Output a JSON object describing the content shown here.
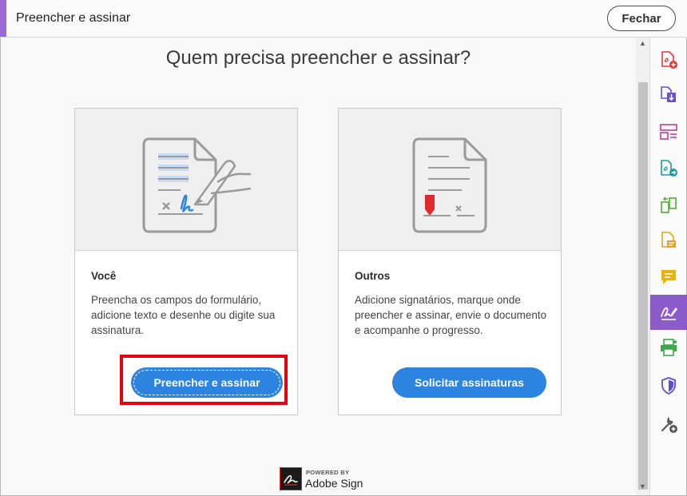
{
  "header": {
    "title": "Preencher e assinar",
    "close_label": "Fechar"
  },
  "main": {
    "question": "Quem precisa preencher e assinar?",
    "cards": [
      {
        "heading": "Você",
        "description": "Preencha os campos do formulário, adicione texto e desenhe ou digite sua assinatura.",
        "button_label": "Preencher e assinar"
      },
      {
        "heading": "Outros",
        "description": "Adicione signatários, marque onde preencher e assinar, envie o documento e acompanhe o progresso.",
        "button_label": "Solicitar assinaturas"
      }
    ]
  },
  "footer": {
    "powered_by": "POWERED BY",
    "brand": "Adobe Sign"
  },
  "tools": [
    {
      "icon": "create-pdf-icon",
      "color": "#e0393e"
    },
    {
      "icon": "export-pdf-icon",
      "color": "#6a4fd8"
    },
    {
      "icon": "organize-pages-icon",
      "color": "#d03a8e"
    },
    {
      "icon": "send-pdf-icon",
      "color": "#1f9a9a"
    },
    {
      "icon": "compare-files-icon",
      "color": "#53a83b"
    },
    {
      "icon": "edit-pdf-icon",
      "color": "#e2a51f"
    },
    {
      "icon": "comment-icon",
      "color": "#e6b215"
    },
    {
      "icon": "fill-sign-icon",
      "color": "#ffffff",
      "active": true
    },
    {
      "icon": "print-production-icon",
      "color": "#3da84a"
    },
    {
      "icon": "protect-icon",
      "color": "#5b4fcf"
    },
    {
      "icon": "more-tools-icon",
      "color": "#555555"
    }
  ],
  "colors": {
    "accent": "#9b6ad6",
    "primary_button": "#2c83e0",
    "active_tool": "#8b5cc9",
    "highlight": "#e8000f"
  }
}
